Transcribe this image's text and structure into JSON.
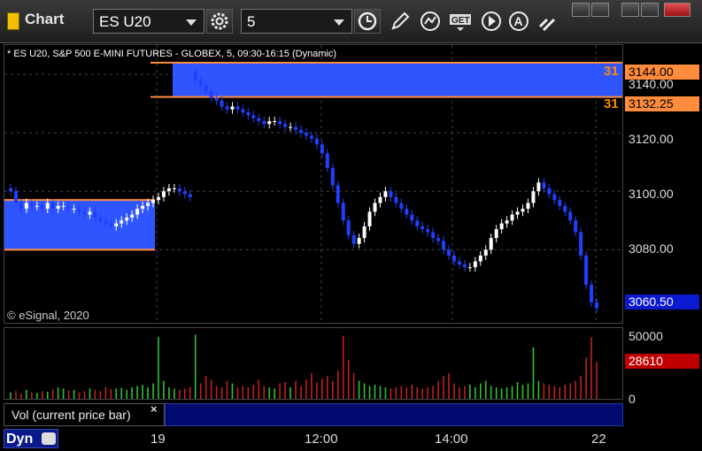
{
  "window": {
    "title": "Chart",
    "symbol_value": "ES U20",
    "interval_value": "5"
  },
  "chart": {
    "title": "* ES U20, S&P 500 E-MINI FUTURES - GLOBEX, 5, 09:30-16:15 (Dynamic)",
    "copyright": "© eSignal, 2020",
    "y_ticks": [
      "3140.00",
      "3120.00",
      "3100.00",
      "3080.00"
    ],
    "x_ticks": [
      "19",
      "12:00",
      "14:00",
      "22"
    ],
    "price_labels": {
      "top": "3144.00",
      "bottom": "3132.25",
      "last": "3060.50"
    },
    "count_labels": {
      "top": "31",
      "bottom": "31"
    },
    "colors": {
      "up": "#ffffff",
      "down": "#2040ff",
      "zone": "#2f55ff",
      "zone_line": "#ff8c3c",
      "last": "#0a1ad0"
    }
  },
  "volume": {
    "legend": "Vol (current price bar)",
    "close_glyph": "×",
    "y_ticks": [
      "50000",
      "0"
    ],
    "last": "28610",
    "colors": {
      "up": "#30c030",
      "down": "#c02020",
      "last": "#c00000"
    }
  },
  "status": {
    "dyn_label": "Dyn"
  },
  "chart_data": {
    "type": "candlestick",
    "title": "* ES U20, S&P 500 E-MINI FUTURES - GLOBEX, 5, 09:30-16:15 (Dynamic)",
    "ylim": [
      3055,
      3150
    ],
    "y_ticks": [
      3140,
      3120,
      3100,
      3080
    ],
    "x_ticks": [
      "19",
      "12:00",
      "14:00",
      "22"
    ],
    "zones": [
      {
        "low": 3080,
        "high": 3097
      },
      {
        "low": 3132.25,
        "high": 3144
      }
    ],
    "last_price": 3060.5,
    "closes": [
      3100,
      3096,
      3094,
      3096,
      3095,
      3095,
      3094,
      3096,
      3094,
      3095,
      3095,
      3094,
      3094,
      3093,
      3092,
      3093,
      3091,
      3090,
      3089,
      3088,
      3089,
      3090,
      3091,
      3092,
      3094,
      3095,
      3096,
      3097,
      3098,
      3100,
      3101,
      3101,
      3100,
      3099,
      3098,
      3138,
      3136,
      3134,
      3132,
      3131,
      3129,
      3128,
      3129,
      3128,
      3127,
      3126,
      3125,
      3124,
      3123,
      3124,
      3124,
      3123,
      3122,
      3122,
      3121,
      3120,
      3119,
      3118,
      3116,
      3113,
      3108,
      3102,
      3096,
      3090,
      3085,
      3082,
      3084,
      3088,
      3093,
      3096,
      3098,
      3100,
      3098,
      3096,
      3094,
      3092,
      3090,
      3088,
      3087,
      3086,
      3084,
      3083,
      3080,
      3078,
      3076,
      3075,
      3074,
      3074,
      3076,
      3078,
      3080,
      3084,
      3087,
      3089,
      3090,
      3092,
      3093,
      3094,
      3096,
      3100,
      3103,
      3101,
      3099,
      3097,
      3095,
      3093,
      3090,
      3086,
      3078,
      3068,
      3062,
      3060
    ],
    "volume": [
      5000,
      6000,
      4000,
      7000,
      5000,
      4500,
      6000,
      5500,
      7500,
      9000,
      8000,
      6500,
      7000,
      5000,
      6000,
      8000,
      7000,
      6000,
      9000,
      7500,
      8000,
      8500,
      7000,
      9000,
      10000,
      11000,
      9000,
      12000,
      48000,
      14000,
      9000,
      8000,
      7000,
      8000,
      9000,
      50000,
      12000,
      18000,
      15000,
      10000,
      9000,
      14000,
      12000,
      9000,
      10000,
      9000,
      11000,
      15000,
      10000,
      9000,
      8000,
      12000,
      13000,
      9000,
      14000,
      10000,
      15000,
      20000,
      13000,
      16000,
      18000,
      14000,
      22000,
      49000,
      30000,
      20000,
      14000,
      12000,
      10000,
      11000,
      10000,
      9000,
      8000,
      9000,
      10000,
      9000,
      11000,
      9000,
      8000,
      9000,
      10000,
      14000,
      18000,
      20000,
      12000,
      9000,
      10000,
      11000,
      9000,
      12000,
      14000,
      10000,
      9000,
      8000,
      9000,
      10000,
      13000,
      11000,
      12000,
      40000,
      14000,
      12000,
      11000,
      10000,
      9000,
      11000,
      12000,
      14000,
      18000,
      32000,
      48000,
      28610
    ],
    "volume_ylim": [
      0,
      55000
    ]
  }
}
